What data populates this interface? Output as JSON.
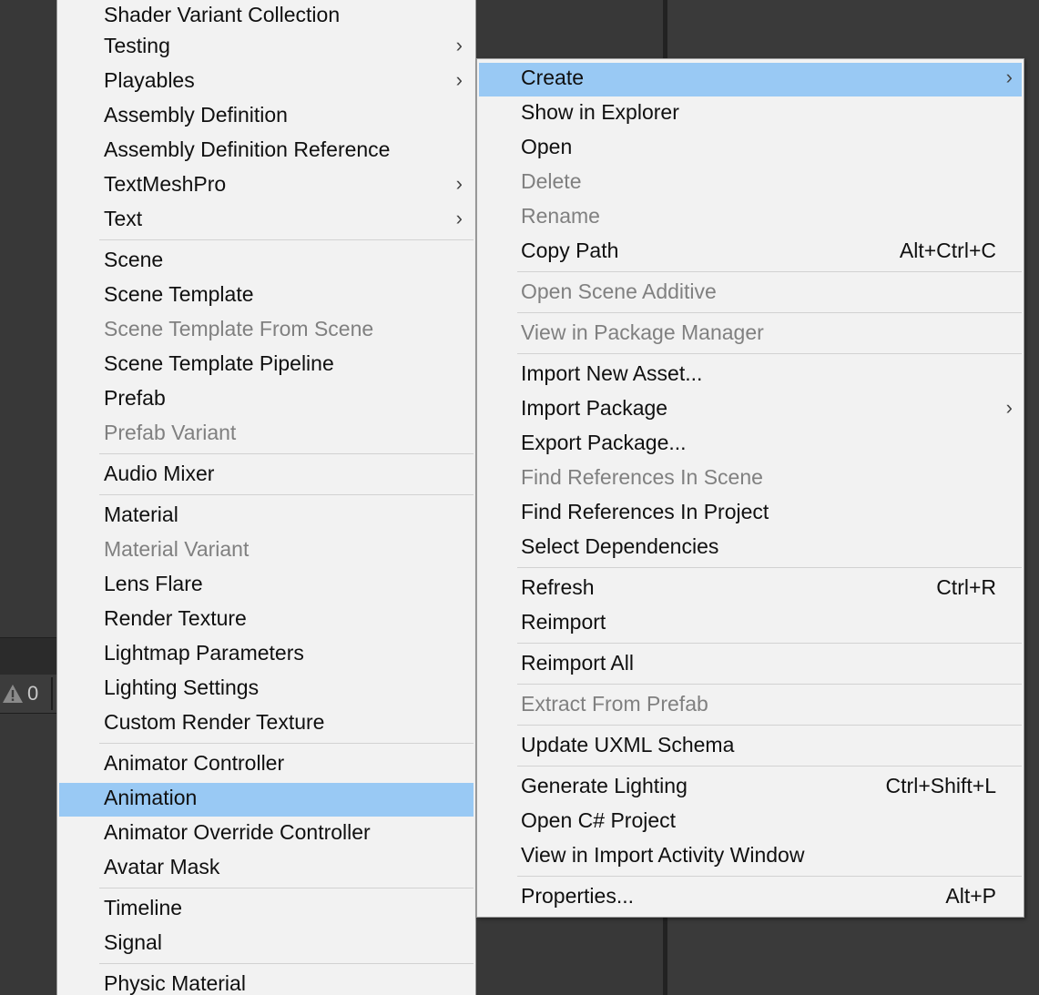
{
  "status_bar": {
    "warning_icon": "warning-triangle-icon",
    "warning_count": "0"
  },
  "create_submenu": {
    "items": [
      {
        "label": "Shader Variant Collection"
      },
      {
        "label": "Testing",
        "submenu": true
      },
      {
        "label": "Playables",
        "submenu": true
      },
      {
        "label": "Assembly Definition"
      },
      {
        "label": "Assembly Definition Reference"
      },
      {
        "label": "TextMeshPro",
        "submenu": true
      },
      {
        "label": "Text",
        "submenu": true
      },
      {
        "label": "Scene"
      },
      {
        "label": "Scene Template"
      },
      {
        "label": "Scene Template From Scene",
        "disabled": true
      },
      {
        "label": "Scene Template Pipeline"
      },
      {
        "label": "Prefab"
      },
      {
        "label": "Prefab Variant",
        "disabled": true
      },
      {
        "label": "Audio Mixer"
      },
      {
        "label": "Material"
      },
      {
        "label": "Material Variant",
        "disabled": true
      },
      {
        "label": "Lens Flare"
      },
      {
        "label": "Render Texture"
      },
      {
        "label": "Lightmap Parameters"
      },
      {
        "label": "Lighting Settings"
      },
      {
        "label": "Custom Render Texture"
      },
      {
        "label": "Animator Controller"
      },
      {
        "label": "Animation",
        "selected": true
      },
      {
        "label": "Animator Override Controller"
      },
      {
        "label": "Avatar Mask"
      },
      {
        "label": "Timeline"
      },
      {
        "label": "Signal"
      },
      {
        "label": "Physic Material"
      }
    ]
  },
  "context_menu": {
    "items": [
      {
        "label": "Create",
        "submenu": true,
        "selected": true
      },
      {
        "label": "Show in Explorer"
      },
      {
        "label": "Open"
      },
      {
        "label": "Delete",
        "disabled": true
      },
      {
        "label": "Rename",
        "disabled": true
      },
      {
        "label": "Copy Path",
        "shortcut": "Alt+Ctrl+C"
      },
      {
        "label": "Open Scene Additive",
        "disabled": true
      },
      {
        "label": "View in Package Manager",
        "disabled": true
      },
      {
        "label": "Import New Asset..."
      },
      {
        "label": "Import Package",
        "submenu": true
      },
      {
        "label": "Export Package..."
      },
      {
        "label": "Find References In Scene",
        "disabled": true
      },
      {
        "label": "Find References In Project"
      },
      {
        "label": "Select Dependencies"
      },
      {
        "label": "Refresh",
        "shortcut": "Ctrl+R"
      },
      {
        "label": "Reimport"
      },
      {
        "label": "Reimport All"
      },
      {
        "label": "Extract From Prefab",
        "disabled": true
      },
      {
        "label": "Update UXML Schema"
      },
      {
        "label": "Generate Lighting",
        "shortcut": "Ctrl+Shift+L"
      },
      {
        "label": "Open C# Project"
      },
      {
        "label": "View in Import Activity Window"
      },
      {
        "label": "Properties...",
        "shortcut": "Alt+P"
      }
    ]
  },
  "colors": {
    "menu_bg": "#f2f2f2",
    "highlight": "#99c9f4",
    "disabled_text": "#808080",
    "editor_bg": "#383838"
  }
}
